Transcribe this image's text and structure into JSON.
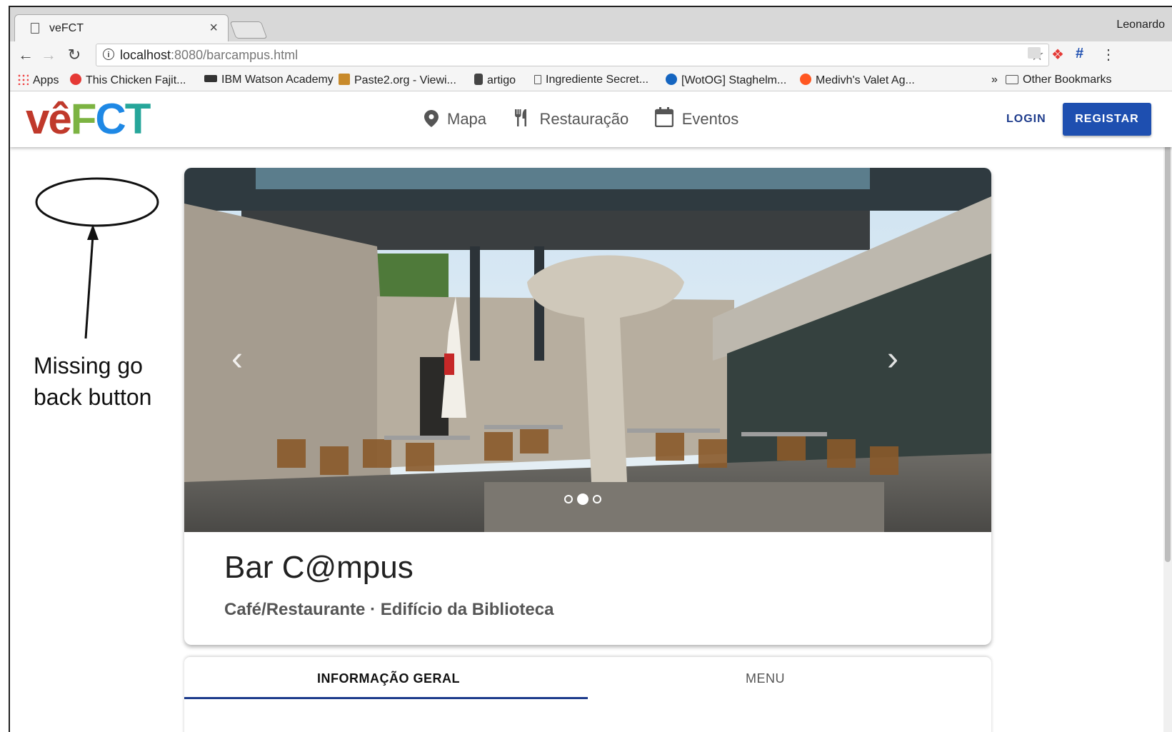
{
  "browser": {
    "tab_title": "veFCT",
    "tab_close": "×",
    "profile_name": "Leonardo",
    "url_host": "localhost",
    "url_rest": ":8080/barcampus.html",
    "bookmarks": [
      {
        "label": "Apps",
        "icon": "apps-grid-icon"
      },
      {
        "label": "This Chicken Fajit...",
        "icon": "recipe-icon",
        "color": "#e53935"
      },
      {
        "label": "IBM Watson Academy",
        "icon": "ibm-icon"
      },
      {
        "label": "Paste2.org - Viewi...",
        "icon": "clipboard-icon",
        "color": "#c88a2b"
      },
      {
        "label": "artigo",
        "icon": "art-icon"
      },
      {
        "label": "Ingrediente Secret...",
        "icon": "page-icon"
      },
      {
        "label": "[WotOG] Staghelm...",
        "icon": "wotog-icon",
        "color": "#1565c0"
      },
      {
        "label": "Medivh's Valet Ag...",
        "icon": "reddit-icon",
        "color": "#ff5722"
      }
    ],
    "overflow": "»",
    "other_bookmarks": "Other Bookmarks"
  },
  "appbar": {
    "logo": {
      "v": "vê",
      "f": "F",
      "c": "C",
      "t": "T"
    },
    "nav": [
      {
        "label": "Mapa",
        "icon": "map-pin-icon"
      },
      {
        "label": "Restauração",
        "icon": "fork-knife-icon"
      },
      {
        "label": "Eventos",
        "icon": "calendar-icon"
      }
    ],
    "login": "LOGIN",
    "register": "REGISTAR",
    "colors": {
      "primary": "#1e4fb0",
      "logo_red": "#c0392b",
      "logo_green": "#7cb342",
      "logo_blue": "#1e88e5",
      "logo_teal": "#26a69a"
    }
  },
  "annotation": {
    "line1": "Missing go",
    "line2": "back button"
  },
  "place": {
    "name": "Bar C@mpus",
    "subtitle": "Café/Restaurante · Edifício da Biblioteca",
    "carousel_slide": 2,
    "carousel_total": 3
  },
  "tabs": [
    {
      "label": "INFORMAÇÃO GERAL",
      "active": true
    },
    {
      "label": "MENU",
      "active": false
    }
  ]
}
